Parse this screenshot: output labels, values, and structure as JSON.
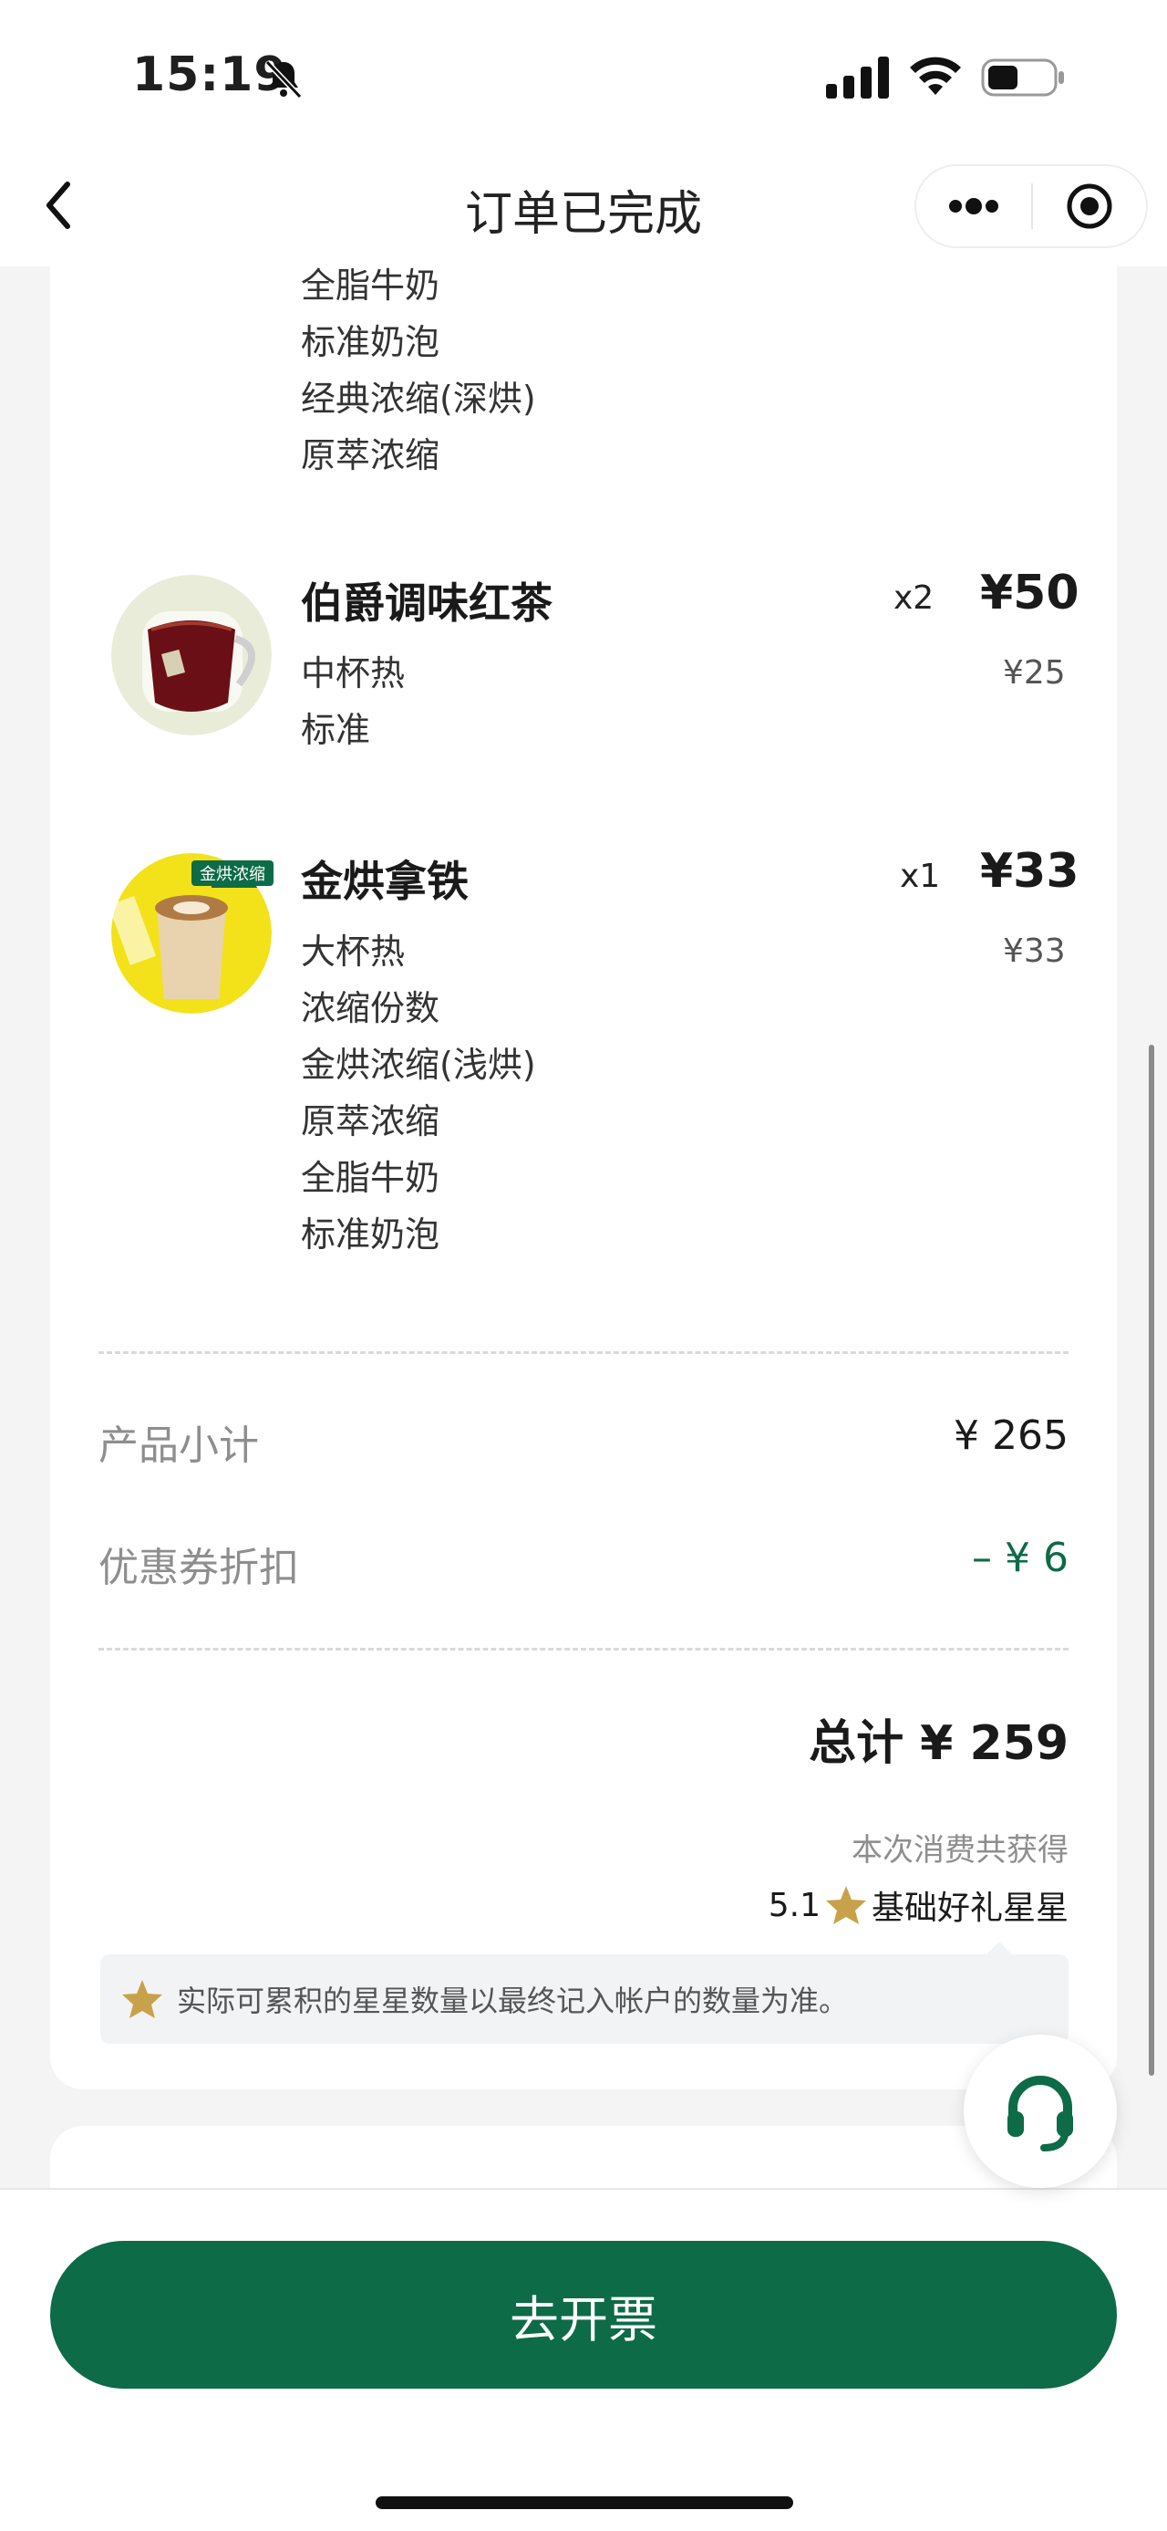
{
  "status": {
    "time": "15:19"
  },
  "nav": {
    "title": "订单已完成"
  },
  "items": [
    {
      "name": "",
      "options": [
        "全脂牛奶",
        "标准奶泡",
        "经典浓缩(深烘)",
        "原萃浓缩"
      ]
    },
    {
      "name": "伯爵调味红茶",
      "qty": "x2",
      "price": "¥50",
      "unit_price": "¥25",
      "options": [
        "中杯热",
        "标准"
      ]
    },
    {
      "name": "金烘拿铁",
      "qty": "x1",
      "price": "¥33",
      "unit_price": "¥33",
      "badge": "金烘浓缩",
      "options": [
        "大杯热",
        "浓缩份数",
        "金烘浓缩(浅烘)",
        "原萃浓缩",
        "全脂牛奶",
        "标准奶泡"
      ]
    }
  ],
  "summary": {
    "subtotal_label": "产品小计",
    "subtotal_value": "¥ 265",
    "coupon_label": "优惠券折扣",
    "coupon_value": "– ¥ 6",
    "total": "总计 ¥ 259",
    "earn_caption": "本次消费共获得",
    "earn_amount": "5.1",
    "earn_label": "基础好礼星星",
    "note": "实际可累积的星星数量以最终记入帐户的数量为准。"
  },
  "footer": {
    "invoice_button": "去开票"
  },
  "colors": {
    "brand_green": "#0d6b47",
    "star_gold": "#c8a24a"
  },
  "icons": [
    "back-icon",
    "more-icon",
    "target-icon",
    "star-icon",
    "headset-icon",
    "bell-slash-icon",
    "signal-icon",
    "wifi-icon",
    "battery-icon"
  ]
}
